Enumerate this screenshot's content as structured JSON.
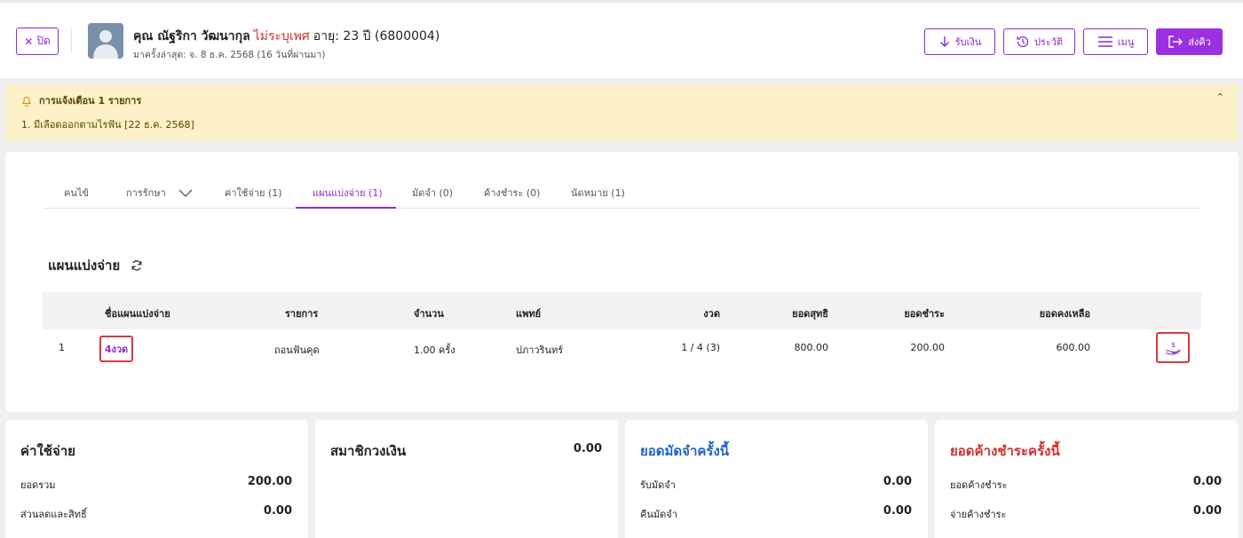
{
  "header": {
    "close_label": "ปิด",
    "patient_name": "คุณ ณัฐริกา วัฒนากุล",
    "gender": "ไม่ระบุเพศ",
    "age": "อายุ: 23 ปี  (6800004)",
    "last_visit": "มาครั้งล่าสุด: จ. 8 ธ.ค. 2568 (16 วันที่ผ่านมา)",
    "buttons": {
      "receive": "รับเงิน",
      "history": "ประวัติ",
      "menu": "เมนู",
      "send_queue": "ส่งคิว"
    }
  },
  "alert": {
    "title": "การแจ้งเตือน 1 รายการ",
    "items": [
      "1. มีเลือดออกตามไรฟัน [22 ธ.ค. 2568]"
    ]
  },
  "tabs": [
    {
      "label": "คนไข้"
    },
    {
      "label": "การรักษา"
    },
    {
      "label": "ค่าใช้จ่าย (1)"
    },
    {
      "label": "แผนแบ่งจ่าย (1)"
    },
    {
      "label": "มัดจำ (0)"
    },
    {
      "label": "ค้างชำระ (0)"
    },
    {
      "label": "นัดหมาย (1)"
    }
  ],
  "active_tab": "แผนแบ่งจ่าย (1)",
  "section": {
    "title": "แผนแบ่งจ่าย"
  },
  "table": {
    "headers": [
      "ชื่อแผนแบ่งจ่าย",
      "รายการ",
      "จำนวน",
      "แพทย์",
      "งวด",
      "ยอดสุทธิ",
      "ยอดชำระ",
      "ยอดคงเหลือ"
    ],
    "rows": [
      {
        "no": "1",
        "plan_name": "4งวด",
        "item": "ถอนฟันคุด",
        "qty": "1.00 ครั้ง",
        "doctor": "ปภาวรินทร์",
        "installment": "1 / 4 (3)",
        "net": "800.00",
        "paid": "200.00",
        "balance": "600.00"
      }
    ]
  },
  "summary": {
    "expenses": {
      "title": "ค่าใช้จ่าย",
      "total_label": "ยอดรวม",
      "total": "200.00",
      "discount_label": "ส่วนลดและสิทธิ์",
      "discount": "0.00"
    },
    "membership": {
      "title": "สมาชิกวงเงิน",
      "value": "0.00"
    },
    "deposit": {
      "title": "ยอดมัดจำครั้งนี้",
      "receive_label": "รับมัดจำ",
      "receive": "0.00",
      "refund_label": "คืนมัดจำ",
      "refund": "0.00"
    },
    "outstanding": {
      "title": "ยอดค้างชำระครั้งนี้",
      "owed_label": "ยอดค้างชำระ",
      "owed": "0.00",
      "pay_label": "จ่ายค้างชำระ",
      "pay": "0.00"
    }
  },
  "colors": {
    "accent": "#8b2ad6",
    "alert_bg": "#fcf1c8",
    "red": "#d32f2f",
    "blue": "#1e63c8"
  }
}
